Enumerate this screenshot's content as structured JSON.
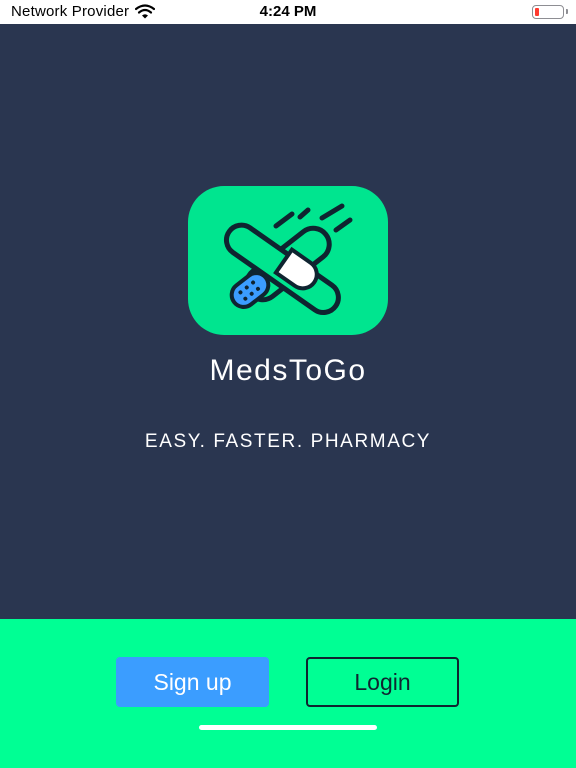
{
  "status_bar": {
    "carrier": "Network Provider",
    "time": "4:24 PM",
    "battery_level": 0.15,
    "battery_color": "#ff3b30"
  },
  "app": {
    "name": "MedsToGo",
    "tagline": "EASY. FASTER. PHARMACY",
    "logo_icon": "bandage-pill-icon"
  },
  "colors": {
    "background": "#2a3650",
    "accent": "#00ff94",
    "logo_tile": "#00e58f",
    "signup_button": "#3b9dff"
  },
  "actions": {
    "signup_label": "Sign up",
    "login_label": "Login"
  }
}
